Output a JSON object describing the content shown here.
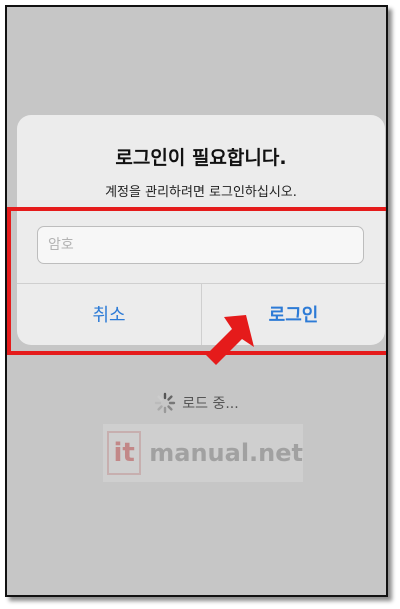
{
  "dialog": {
    "title": "로그인이 필요합니다.",
    "message": "계정을 관리하려면 로그인하십시오.",
    "password_placeholder": "암호",
    "cancel_label": "취소",
    "login_label": "로그인"
  },
  "status": {
    "loading_text": "로드 중..."
  },
  "watermark": {
    "logo_text": "it",
    "site_text": "manual.net"
  },
  "colors": {
    "accent": "#2d7bd6",
    "highlight": "#e51b1b",
    "overlay": "#c6c6c6"
  }
}
